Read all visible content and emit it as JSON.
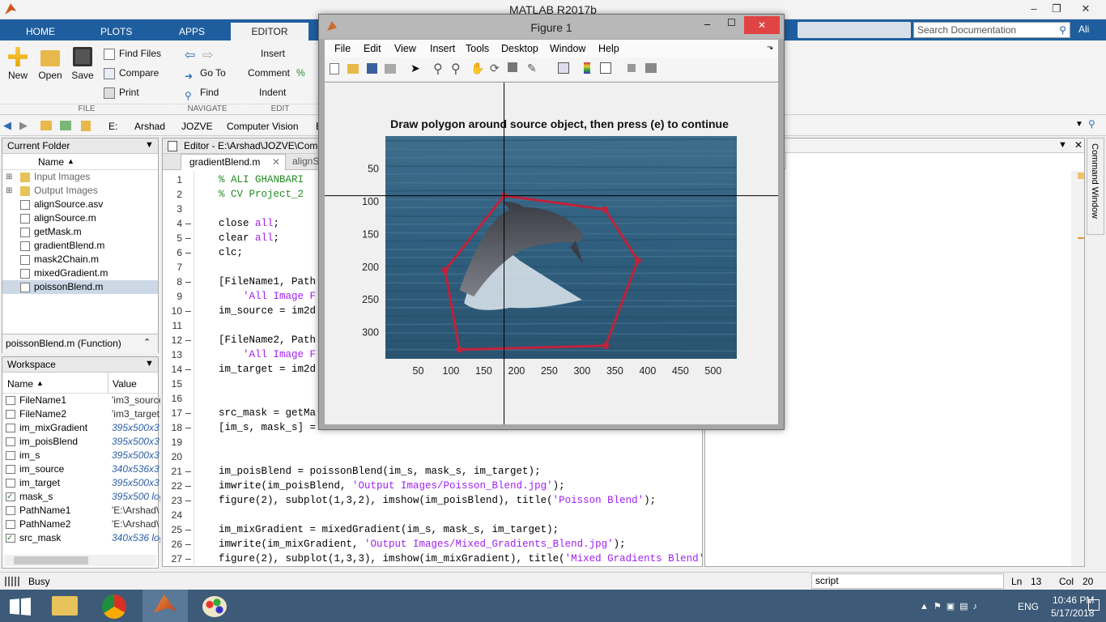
{
  "window": {
    "title": "MATLAB R2017b"
  },
  "ribbon": {
    "tabs": [
      "HOME",
      "PLOTS",
      "APPS",
      "EDITOR"
    ],
    "file": {
      "new": "New",
      "open": "Open",
      "save": "Save",
      "find_files": "Find Files",
      "compare": "Compare",
      "print": "Print",
      "group": "FILE"
    },
    "navigate": {
      "go_to": "Go To",
      "find": "Find",
      "group": "NAVIGATE"
    },
    "edit": {
      "insert": "Insert",
      "comment": "Comment",
      "indent": "Indent",
      "group": "EDIT"
    },
    "search_placeholder": "Search Documentation",
    "user": "Ali"
  },
  "address": {
    "parts": [
      "E:",
      "Arshad",
      "JOZVE",
      "Computer Vision",
      "E"
    ]
  },
  "current_folder": {
    "title": "Current Folder",
    "column": "Name",
    "items": [
      "Input Images",
      "Output Images",
      "alignSource.asv",
      "alignSource.m",
      "getMask.m",
      "gradientBlend.m",
      "mask2Chain.m",
      "mixedGradient.m",
      "poissonBlend.m"
    ],
    "details": "poissonBlend.m  (Function)"
  },
  "workspace": {
    "title": "Workspace",
    "col_name": "Name",
    "col_value": "Value",
    "rows": [
      {
        "name": "FileName1",
        "value": "'im3_source"
      },
      {
        "name": "FileName2",
        "value": "'im3_target"
      },
      {
        "name": "im_mixGradient",
        "value": "395x500x3 d"
      },
      {
        "name": "im_poisBlend",
        "value": "395x500x3 d"
      },
      {
        "name": "im_s",
        "value": "395x500x3 d"
      },
      {
        "name": "im_source",
        "value": "340x536x3 d"
      },
      {
        "name": "im_target",
        "value": "395x500x3 d"
      },
      {
        "name": "mask_s",
        "value": "395x500 log"
      },
      {
        "name": "PathName1",
        "value": "'E:\\Arshad\\"
      },
      {
        "name": "PathName2",
        "value": "'E:\\Arshad\\"
      },
      {
        "name": "src_mask",
        "value": "340x536 log"
      }
    ]
  },
  "editor": {
    "title": "Editor - E:\\Arshad\\JOZVE\\Comp",
    "tabs": [
      "gradientBlend.m",
      "alignS"
    ],
    "lines": [
      {
        "n": "1",
        "d": "",
        "t": "% ALI GHANBARI"
      },
      {
        "n": "2",
        "d": "",
        "t": "% CV Project_2"
      },
      {
        "n": "3",
        "d": "",
        "t": ""
      },
      {
        "n": "4",
        "d": "–",
        "t": "close all;"
      },
      {
        "n": "5",
        "d": "–",
        "t": "clear all;"
      },
      {
        "n": "6",
        "d": "–",
        "t": "clc;"
      },
      {
        "n": "7",
        "d": "",
        "t": ""
      },
      {
        "n": "8",
        "d": "–",
        "t": "[FileName1, Path"
      },
      {
        "n": "9",
        "d": "",
        "t": "    'All Image F"
      },
      {
        "n": "10",
        "d": "–",
        "t": "im_source = im2d"
      },
      {
        "n": "11",
        "d": "",
        "t": ""
      },
      {
        "n": "12",
        "d": "–",
        "t": "[FileName2, Path"
      },
      {
        "n": "13",
        "d": "",
        "t": "    'All Image F"
      },
      {
        "n": "14",
        "d": "–",
        "t": "im_target = im2d"
      },
      {
        "n": "15",
        "d": "",
        "t": ""
      },
      {
        "n": "16",
        "d": "",
        "t": ""
      },
      {
        "n": "17",
        "d": "–",
        "t": "src_mask = getMa"
      },
      {
        "n": "18",
        "d": "–",
        "t": "[im_s, mask_s] = "
      },
      {
        "n": "19",
        "d": "",
        "t": ""
      },
      {
        "n": "20",
        "d": "",
        "t": ""
      },
      {
        "n": "21",
        "d": "–",
        "t": "im_poisBlend = poissonBlend(im_s, mask_s, im_target);"
      },
      {
        "n": "22",
        "d": "–",
        "t": "imwrite(im_poisBlend, 'Output Images/Poisson_Blend.jpg');"
      },
      {
        "n": "23",
        "d": "–",
        "t": "figure(2), subplot(1,3,2), imshow(im_poisBlend), title('Poisson Blend');"
      },
      {
        "n": "24",
        "d": "",
        "t": ""
      },
      {
        "n": "25",
        "d": "–",
        "t": "im_mixGradient = mixedGradient(im_s, mask_s, im_target);"
      },
      {
        "n": "26",
        "d": "–",
        "t": "imwrite(im_mixGradient, 'Output Images/Mixed_Gradients_Blend.jpg');"
      },
      {
        "n": "27",
        "d": "–",
        "t": "figure(2), subplot(1,3,3), imshow(im_mixGradient), title('Mixed Gradients Blend');"
      }
    ]
  },
  "command_window": {
    "label": "Command Window"
  },
  "figure": {
    "title": "Figure 1",
    "menu": [
      "File",
      "Edit",
      "View",
      "Insert",
      "Tools",
      "Desktop",
      "Window",
      "Help"
    ],
    "plot_title": "Draw polygon around source object, then press (e) to continue",
    "xticks": [
      "50",
      "100",
      "150",
      "200",
      "250",
      "300",
      "350",
      "400",
      "450",
      "500"
    ],
    "yticks": [
      "50",
      "100",
      "150",
      "200",
      "250",
      "300"
    ],
    "polygon_color": "#c0223a"
  },
  "chart_data": {
    "type": "scatter",
    "title": "Draw polygon around source object, then press (e) to continue",
    "xlim": [
      0,
      536
    ],
    "ylim": [
      340,
      0
    ],
    "polygon": [
      [
        181,
        91
      ],
      [
        335,
        112
      ],
      [
        385,
        190
      ],
      [
        336,
        320
      ],
      [
        113,
        326
      ],
      [
        91,
        205
      ],
      [
        181,
        91
      ]
    ],
    "crosshair": {
      "x": 181,
      "y": 91
    }
  },
  "status": {
    "busy": "Busy",
    "mode": "script",
    "ln_label": "Ln",
    "ln": "13",
    "col_label": "Col",
    "col": "20"
  },
  "taskbar": {
    "lang": "ENG",
    "time": "10:46 PM",
    "date": "5/17/2018"
  }
}
